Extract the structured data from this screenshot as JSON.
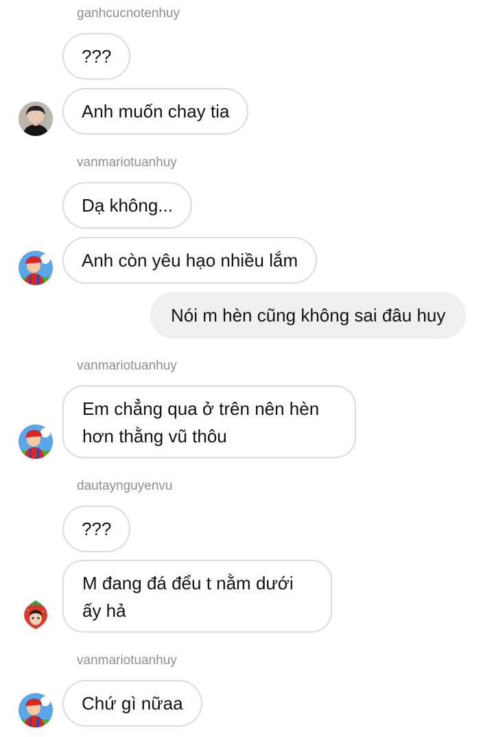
{
  "conversation": {
    "groups": [
      {
        "username": "ganhcucnotenhuy",
        "messages": [
          "???",
          "Anh muốn chay tia"
        ]
      },
      {
        "username": "vanmariotuanhuy",
        "messages": [
          "Dạ không...",
          "Anh còn yêu hạo nhiều lắm"
        ]
      },
      {
        "username": "",
        "outgoing": [
          "Nói m hèn cũng không sai đâu huy"
        ]
      },
      {
        "username": "vanmariotuanhuy",
        "messages": [
          "Em chẳng qua ở trên nên hèn hơn thằng vũ thôu"
        ]
      },
      {
        "username": "dautaynguyenvu",
        "messages": [
          "???",
          "M đang đá đểu t nằm dưới ấy hả"
        ]
      },
      {
        "username": "vanmariotuanhuy",
        "messages": [
          "Chứ gì nữaa"
        ]
      }
    ]
  },
  "colors": {
    "incoming_border": "#dbdbdb",
    "outgoing_bg": "#efefef",
    "username_text": "#8e8e8e",
    "message_text": "#111111"
  },
  "icons": {
    "avatar_ganhcucnotenhuy": "avatar-photo-dark-hair",
    "avatar_vanmariotuanhuy": "avatar-mario-icon",
    "avatar_dautaynguyenvu": "avatar-strawberry-character"
  }
}
